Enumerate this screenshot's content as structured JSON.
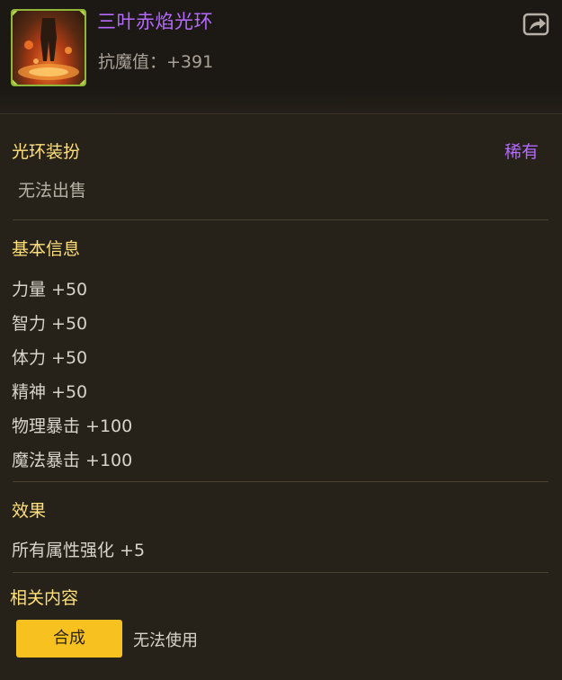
{
  "header": {
    "title": "三叶赤焰光环",
    "resist_label": "抗魔值：",
    "resist_value": "+391",
    "share_icon": "share-icon"
  },
  "colors": {
    "title": "#b569ff",
    "section_title": "#ffe07a",
    "button": "#f7c21f"
  },
  "type_section": {
    "title": "光环装扮",
    "rarity": "稀有",
    "trade_status": "无法出售"
  },
  "basic_info": {
    "title": "基本信息",
    "stats": [
      "力量 +50",
      "智力 +50",
      "体力 +50",
      "精神 +50",
      "物理暴击 +100",
      "魔法暴击 +100"
    ]
  },
  "effect": {
    "title": "效果",
    "text": "所有属性强化 +5"
  },
  "related": {
    "title": "相关内容",
    "craft_button": "合成",
    "use_status": "无法使用"
  }
}
